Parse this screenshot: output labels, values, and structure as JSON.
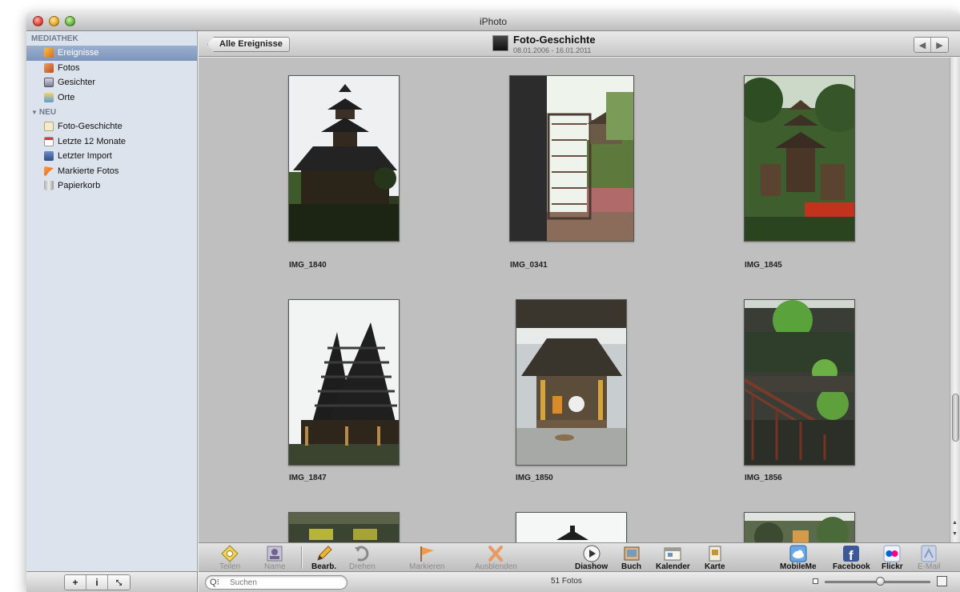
{
  "window": {
    "title": "iPhoto"
  },
  "sidebar": {
    "sections": [
      {
        "title": "MEDIATHEK",
        "items": [
          {
            "label": "Ereignisse",
            "icon": "events-icon",
            "selected": true
          },
          {
            "label": "Fotos",
            "icon": "photos-icon"
          },
          {
            "label": "Gesichter",
            "icon": "faces-icon"
          },
          {
            "label": "Orte",
            "icon": "places-icon"
          }
        ]
      },
      {
        "title": "NEU",
        "items": [
          {
            "label": "Foto-Geschichte",
            "icon": "album-icon"
          },
          {
            "label": "Letzte 12 Monate",
            "icon": "calendar-icon"
          },
          {
            "label": "Letzter Import",
            "icon": "import-icon"
          },
          {
            "label": "Markierte Fotos",
            "icon": "flag-icon"
          },
          {
            "label": "Papierkorb",
            "icon": "trash-icon"
          }
        ]
      }
    ],
    "bottom_buttons": [
      {
        "label": "+",
        "icon": "add-icon"
      },
      {
        "label": "i",
        "icon": "info-icon"
      },
      {
        "label": "⤡",
        "icon": "fullscreen-icon"
      }
    ]
  },
  "header": {
    "back_label": "Alle Ereignisse",
    "event_title": "Foto-Geschichte",
    "event_dates": "08.01.2006 - 16.01.2011",
    "nav_prev": "◀",
    "nav_next": "▶"
  },
  "photos": [
    {
      "name": "IMG_1840"
    },
    {
      "name": "IMG_0341"
    },
    {
      "name": "IMG_1845"
    },
    {
      "name": "IMG_1847"
    },
    {
      "name": "IMG_1850"
    },
    {
      "name": "IMG_1856"
    }
  ],
  "toolbar": {
    "left": [
      {
        "label": "Teilen",
        "icon": "share-icon",
        "enabled": false
      },
      {
        "label": "Name",
        "icon": "name-icon",
        "enabled": false
      },
      {
        "label": "Bearb.",
        "icon": "edit-pencil-icon",
        "enabled": true
      },
      {
        "label": "Drehen",
        "icon": "rotate-icon",
        "enabled": false
      },
      {
        "label": "Markieren",
        "icon": "flag-icon",
        "enabled": false
      },
      {
        "label": "Ausblenden",
        "icon": "hide-x-icon",
        "enabled": false
      }
    ],
    "center": [
      {
        "label": "Diashow",
        "icon": "play-icon",
        "enabled": true
      },
      {
        "label": "Buch",
        "icon": "book-icon",
        "enabled": true
      },
      {
        "label": "Kalender",
        "icon": "calendar-icon",
        "enabled": true
      },
      {
        "label": "Karte",
        "icon": "card-icon",
        "enabled": true
      }
    ],
    "right": [
      {
        "label": "MobileMe",
        "icon": "mobileme-cloud-icon",
        "enabled": true
      },
      {
        "label": "Facebook",
        "icon": "facebook-icon",
        "enabled": true
      },
      {
        "label": "Flickr",
        "icon": "flickr-icon",
        "enabled": true
      },
      {
        "label": "E-Mail",
        "icon": "email-icon",
        "enabled": false
      }
    ]
  },
  "status": {
    "search_placeholder": "Suchen",
    "search_icon_glyph": "Q⁝",
    "photo_count": "51 Fotos",
    "zoom_level": 0.53
  },
  "colors": {
    "sidebar_bg": "#dde3ec",
    "selection": "#7d95bb",
    "content_bg": "#bfbfbf",
    "facebook_blue": "#3b5998",
    "flickr_blue": "#0063dc",
    "flickr_pink": "#ff0084"
  }
}
